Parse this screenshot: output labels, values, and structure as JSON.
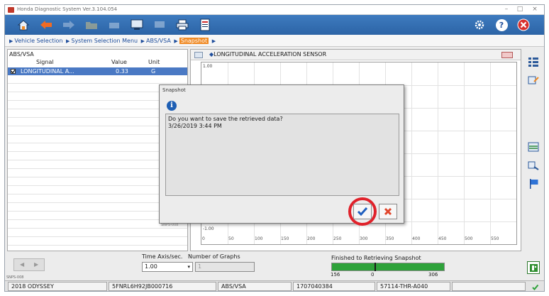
{
  "window": {
    "title": "Honda Diagnostic System Ver.3.104.054",
    "controls": {
      "minimize": "–",
      "maximize": "□",
      "close": "×"
    }
  },
  "toolbar": {
    "buttons": [
      {
        "name": "home",
        "icon": "home-icon"
      },
      {
        "name": "back",
        "icon": "back-arrow-icon"
      },
      {
        "name": "forward",
        "icon": "forward-arrow-icon"
      },
      {
        "name": "folder",
        "icon": "folder-icon"
      },
      {
        "name": "tools",
        "icon": "tools-icon"
      },
      {
        "name": "save",
        "icon": "save-icon"
      },
      {
        "name": "monitor",
        "icon": "monitor-icon"
      },
      {
        "name": "print",
        "icon": "print-icon"
      },
      {
        "name": "snapshot",
        "icon": "snapshot-icon"
      }
    ],
    "right": [
      {
        "name": "settings",
        "icon": "gear-icon"
      },
      {
        "name": "help",
        "icon": "help-icon",
        "label": "?"
      },
      {
        "name": "exit",
        "icon": "exit-icon"
      }
    ]
  },
  "breadcrumb": {
    "items": [
      "Vehicle Selection",
      "System Selection Menu",
      "ABS/VSA"
    ],
    "current": "Snapshot"
  },
  "left_panel": {
    "system": "ABS/VSA",
    "columns": {
      "signal": "Signal",
      "value": "Value",
      "unit": "Unit"
    },
    "selected_row": {
      "signal": "LONGITUDINAL A...",
      "value": "0.33",
      "unit": "G"
    },
    "empty_rows": 20
  },
  "graph": {
    "title": "LONGITUDINAL ACCELERATION SENSOR",
    "y_top": "1.00",
    "y_bottom": "-1.00",
    "x_labels": [
      "0",
      "50",
      "100",
      "150",
      "200",
      "250",
      "300",
      "350",
      "400",
      "450",
      "500",
      "550"
    ]
  },
  "bottom": {
    "time_axis_label": "Time Axis/sec.",
    "time_axis_value": "1.00",
    "graphs_label": "Number of Graphs",
    "graphs_value": "1",
    "status_label": "Finished to Retrieving Snapshot",
    "progress_min": "156",
    "progress_mid": "0",
    "progress_max": "306",
    "progress_fraction": 1.0,
    "tiny_label": "SNPS-008"
  },
  "status_bar": {
    "model": "2018 ODYSSEY",
    "vin": "5FNRL6H92JB000716",
    "system": "ABS/VSA",
    "id": "1707040384",
    "part": "57114-THR-A040"
  },
  "dialog": {
    "title": "Snapshot",
    "message_line1": "Do you want to save the retrieved data?",
    "message_line2": "3/26/2019 3:44 PM",
    "ok_icon": "checkmark-icon",
    "cancel_icon": "x-icon",
    "tiny_label": "SNPS-008"
  },
  "colors": {
    "toolbar": "#2f68ab",
    "breadcrumb_current": "#f08a24",
    "selection": "#4a79c4",
    "highlight": "#e0212a",
    "progress": "#2ea23a"
  }
}
